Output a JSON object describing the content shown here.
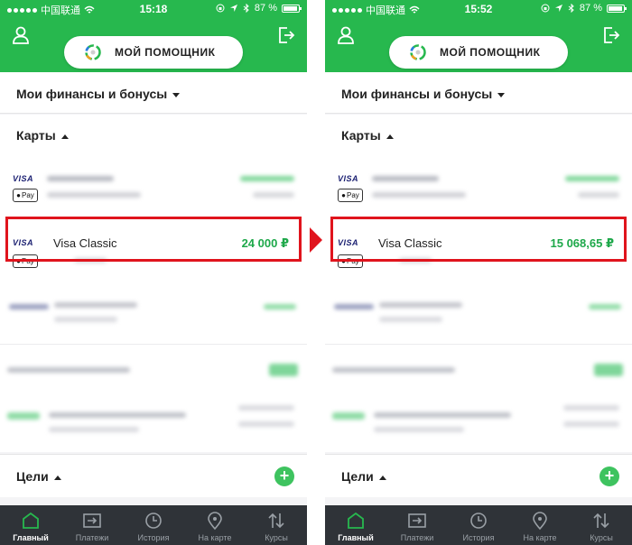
{
  "colors": {
    "brand_green": "#27b84e",
    "balance_green": "#1ea84a",
    "highlight_red": "#e0141d",
    "tabbar": "#2f3338"
  },
  "screens": [
    {
      "status": {
        "carrier": "中国联通",
        "time": "15:18",
        "battery": "87 %"
      },
      "assistant_label": "МОЙ ПОМОЩНИК",
      "finances_title": "Мои финансы и бонусы",
      "cards_title": "Карты",
      "card": {
        "brand": "VISA",
        "pay": "Pay",
        "name": "Visa Classic",
        "balance": "24 000 ₽",
        "mask": "••••"
      },
      "other_card": {
        "brand": "VISA",
        "pay": "Pay"
      },
      "goals_title": "Цели",
      "tabs": [
        "Главный",
        "Платежи",
        "История",
        "На карте",
        "Курсы"
      ]
    },
    {
      "status": {
        "carrier": "中国联通",
        "time": "15:52",
        "battery": "87 %"
      },
      "assistant_label": "МОЙ ПОМОЩНИК",
      "finances_title": "Мои финансы и бонусы",
      "cards_title": "Карты",
      "card": {
        "brand": "VISA",
        "pay": "Pay",
        "name": "Visa Classic",
        "balance": "15 068,65 ₽",
        "mask": "••••"
      },
      "other_card": {
        "brand": "VISA",
        "pay": "Pay"
      },
      "goals_title": "Цели",
      "tabs": [
        "Главный",
        "Платежи",
        "История",
        "На карте",
        "Курсы"
      ]
    }
  ],
  "icons": {
    "user": "user-icon",
    "logout": "logout-icon",
    "assistant": "assistant-logo-icon",
    "home": "home-icon",
    "payments": "transfer-icon",
    "history": "clock-icon",
    "map": "map-pin-icon",
    "rates": "sort-arrows-icon",
    "add": "plus-icon",
    "apple": "apple-icon"
  }
}
